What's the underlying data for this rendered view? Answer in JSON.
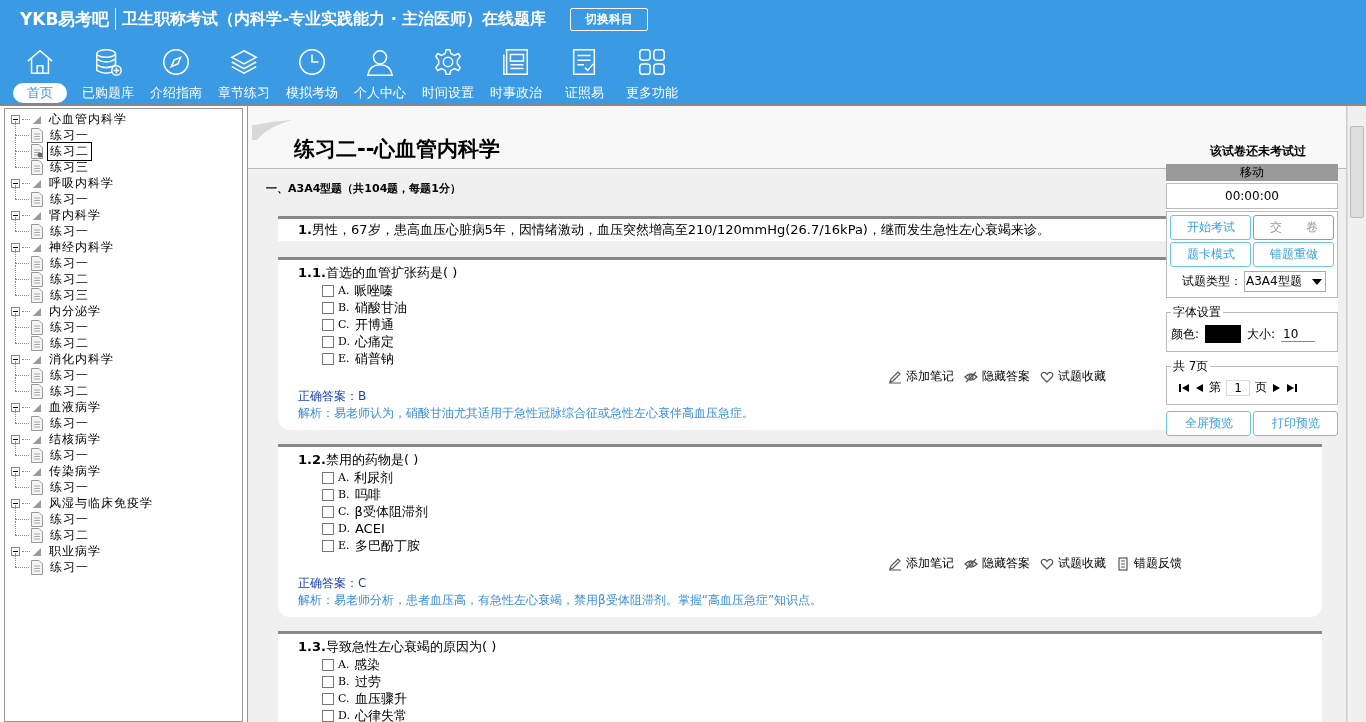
{
  "header": {
    "logo": "YKB易考吧",
    "title": "卫生职称考试（内科学-专业实践能力 · 主治医师）在线题库",
    "switch_button": "切换科目"
  },
  "nav": [
    {
      "label": "首页",
      "selected": true
    },
    {
      "label": "已购题库",
      "selected": false
    },
    {
      "label": "介绍指南",
      "selected": false
    },
    {
      "label": "章节练习",
      "selected": false
    },
    {
      "label": "模拟考场",
      "selected": false
    },
    {
      "label": "个人中心",
      "selected": false
    },
    {
      "label": "时间设置",
      "selected": false
    },
    {
      "label": "时事政治",
      "selected": false
    },
    {
      "label": "证照易",
      "selected": false
    },
    {
      "label": "更多功能",
      "selected": false
    }
  ],
  "tree": [
    {
      "label": "心血管内科学",
      "expanded": true,
      "children": [
        {
          "label": "练习一",
          "selected": false
        },
        {
          "label": "练习二",
          "selected": true
        },
        {
          "label": "练习三",
          "selected": false
        }
      ]
    },
    {
      "label": "呼吸内科学",
      "expanded": true,
      "children": [
        {
          "label": "练习一",
          "selected": false
        }
      ]
    },
    {
      "label": "肾内科学",
      "expanded": true,
      "children": [
        {
          "label": "练习一",
          "selected": false
        }
      ]
    },
    {
      "label": "神经内科学",
      "expanded": true,
      "children": [
        {
          "label": "练习一",
          "selected": false
        },
        {
          "label": "练习二",
          "selected": false
        },
        {
          "label": "练习三",
          "selected": false
        }
      ]
    },
    {
      "label": "内分泌学",
      "expanded": true,
      "children": [
        {
          "label": "练习一",
          "selected": false
        },
        {
          "label": "练习二",
          "selected": false
        }
      ]
    },
    {
      "label": "消化内科学",
      "expanded": true,
      "children": [
        {
          "label": "练习一",
          "selected": false
        },
        {
          "label": "练习二",
          "selected": false
        }
      ]
    },
    {
      "label": "血液病学",
      "expanded": true,
      "children": [
        {
          "label": "练习一",
          "selected": false
        }
      ]
    },
    {
      "label": "结核病学",
      "expanded": true,
      "children": [
        {
          "label": "练习一",
          "selected": false
        }
      ]
    },
    {
      "label": "传染病学",
      "expanded": true,
      "children": [
        {
          "label": "练习一",
          "selected": false
        }
      ]
    },
    {
      "label": "风湿与临床免疫学",
      "expanded": true,
      "children": [
        {
          "label": "练习一",
          "selected": false
        },
        {
          "label": "练习二",
          "selected": false
        }
      ]
    },
    {
      "label": "职业病学",
      "expanded": true,
      "children": [
        {
          "label": "练习一",
          "selected": false
        }
      ]
    }
  ],
  "paper": {
    "title": "练习二--心血管内科学",
    "status": "该试卷还未考试过",
    "section": "一、A3A4型题（共104题，每题1分）",
    "case": {
      "number": "1.",
      "text": "男性，67岁，患高血压心脏病5年，因情绪激动，血压突然增高至210/120mmHg(26.7/16kPa)，继而发生急性左心衰竭来诊。"
    },
    "questions": [
      {
        "number": "1.1.",
        "stem": "首选的血管扩张药是( )",
        "options": [
          {
            "label": "A.",
            "text": "哌唑嗪",
            "checked": false
          },
          {
            "label": "B.",
            "text": "硝酸甘油",
            "checked": false
          },
          {
            "label": "C.",
            "text": "开博通",
            "checked": false
          },
          {
            "label": "D.",
            "text": "心痛定",
            "checked": false
          },
          {
            "label": "E.",
            "text": "硝普钠",
            "checked": false
          }
        ],
        "actions": [
          "添加笔记",
          "隐藏答案",
          "试题收藏"
        ],
        "answer": "正确答案：B",
        "analysis": "解析：易老师认为，硝酸甘油尤其适用于急性冠脉综合征或急性左心衰伴高血压急症。"
      },
      {
        "number": "1.2.",
        "stem": "禁用的药物是( )",
        "options": [
          {
            "label": "A.",
            "text": "利尿剂",
            "checked": false
          },
          {
            "label": "B.",
            "text": "吗啡",
            "checked": false
          },
          {
            "label": "C.",
            "text": "β受体阻滞剂",
            "checked": false
          },
          {
            "label": "D.",
            "text": "ACEI",
            "checked": false
          },
          {
            "label": "E.",
            "text": "多巴酚丁胺",
            "checked": false
          }
        ],
        "actions": [
          "添加笔记",
          "隐藏答案",
          "试题收藏",
          "错题反馈"
        ],
        "answer": "正确答案：C",
        "analysis": "解析：易老师分析，患者血压高，有急性左心衰竭，禁用β受体阻滞剂。掌握“高血压急症”知识点。"
      },
      {
        "number": "1.3.",
        "stem": "导致急性左心衰竭的原因为( )",
        "options": [
          {
            "label": "A.",
            "text": "感染",
            "checked": false
          },
          {
            "label": "B.",
            "text": "过劳",
            "checked": false
          },
          {
            "label": "C.",
            "text": "血压骤升",
            "checked": false
          },
          {
            "label": "D.",
            "text": "心律失常",
            "checked": false
          }
        ]
      }
    ]
  },
  "panel": {
    "title": "移动",
    "timer": "00:00:00",
    "buttons": [
      {
        "label": "开始考试",
        "disabled": false
      },
      {
        "label": "交　　卷",
        "disabled": true
      },
      {
        "label": "题卡模式",
        "disabled": false
      },
      {
        "label": "错题重做",
        "disabled": false
      }
    ],
    "type_label": "试题类型：",
    "type_value": "A3A4型题",
    "font_legend": "字体设置",
    "color_label": "颜色:",
    "color": "#000000",
    "size_label": "大小:",
    "size_value": "10",
    "pages_legend": "共 7页",
    "page_prefix": "第",
    "page_value": "1",
    "page_suffix": "页",
    "bottom_buttons": [
      "全屏预览",
      "打印预览"
    ]
  }
}
